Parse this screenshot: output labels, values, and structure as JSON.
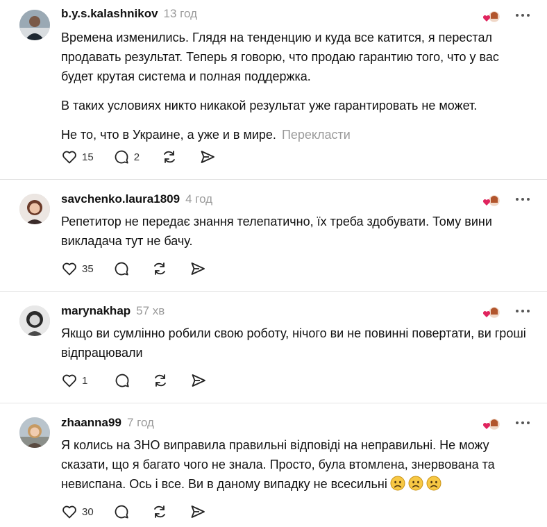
{
  "posts": [
    {
      "username": "b.y.s.kalashnikov",
      "time": "13 год",
      "paragraphs": [
        "Времена изменились. Глядя на тенденцию и куда все катится, я перестал продавать результат. Теперь я говорю, что продаю гарантию того, что у вас будет крутая система и полная поддержка.",
        "В таких условиях никто никакой результат уже гарантировать не может.",
        "Не то, что в Украине, а уже и в мире."
      ],
      "translate_label": "Перекласти",
      "likes": "15",
      "replies": "2"
    },
    {
      "username": "savchenko.laura1809",
      "time": "4 год",
      "paragraphs": [
        "Репетитор не передає знання телепатично, їх треба здобувати. Тому вини викладача тут не бачу."
      ],
      "likes": "35",
      "replies": ""
    },
    {
      "username": "marynakhap",
      "time": "57 хв",
      "paragraphs": [
        "Якщо ви сумлінно робили свою роботу, нічого ви не повинні повертати, ви гроші відпрацювали"
      ],
      "likes": "1",
      "replies": ""
    },
    {
      "username": "zhaanna99",
      "time": "7 год",
      "paragraphs": [
        "Я колись на ЗНО виправила правильні відповіді на неправильні. Не можу сказати, що я багато чого не знала. Просто, була втомлена, знервована та невиспана. Ось і все. Ви в даному випадку не всесильні"
      ],
      "emojis": [
        "worried-face-icon",
        "worried-face-icon",
        "worried-face-icon"
      ],
      "likes": "30",
      "replies": ""
    }
  ],
  "colors": {
    "text": "#111111",
    "muted": "#9a9a9a",
    "divider": "#e4e4e4",
    "liked_heart": "#e0245e"
  }
}
